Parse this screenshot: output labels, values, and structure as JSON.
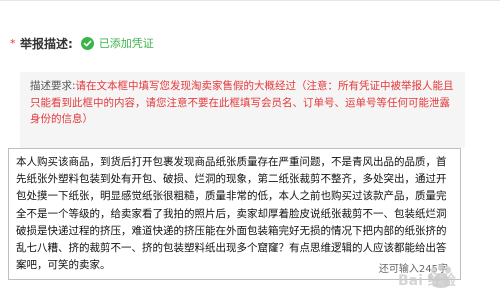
{
  "form": {
    "required_mark": "*",
    "label": "举报描述:",
    "status_text": "已添加凭证"
  },
  "notice": {
    "prefix": "描述要求:",
    "text": "请在文本框中填写您发现淘卖家售假的大概经过（注意：所有凭证中被举报人能且只能看到此框中的内容，请您注意不要在此框填写会员名、订单号、运单号等任何可能泄露身份的信息）"
  },
  "description": {
    "value": "本人购买该商品，到货后打开包裹发现商品纸张质量存在严重问题，不是青风出品的品质，首先纸张外塑料包装到处有开包、破损、烂洞的现象，第二纸张裁剪不整齐，多处突出，通过开包处摸一下纸张，明显感觉纸张很粗糙，质量非常的低，本人之前也购买过该款产品，质量完全不是一个等级的，给卖家看了我拍的照片后，卖家却厚着脸皮说纸张裁剪不一、包装纸烂洞破损是快递过程的挤压，难道快递的挤压能在外面包装箱完好无损的情况下把内部的纸张挤的乱七八糟、挤的裁剪不一、挤的包装塑料纸出现多个窟窿？有点思维逻辑的人应该都能给出答案吧，可笑的卖家。",
    "counter": "还可输入245字"
  },
  "watermark": {
    "text": "Bai 经验"
  },
  "colors": {
    "accent_red": "#e4393c",
    "success_green": "#3bb44a",
    "notice_bg": "#f5f5f5"
  }
}
